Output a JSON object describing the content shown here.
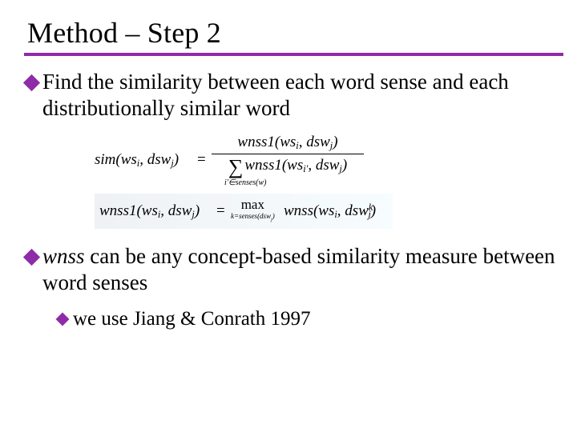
{
  "title": "Method – Step 2",
  "bullets": {
    "b1": "Find the similarity between each word sense and each distributionally similar word",
    "b2_lead": "wnss",
    "b2_rest": " can be any concept-based similarity measure between word senses",
    "b2_sub": "we use Jiang & Conrath 1997"
  },
  "equations": {
    "eq1": {
      "lhs": "sim(ws_i, dsw_j)",
      "numerator": "wnss1(ws_i, dsw_j)",
      "denominator_sum_sub": "i'∈senses(w)",
      "denominator_term": "wnss1(ws_{i'}, dsw_j)"
    },
    "eq2": {
      "lhs": "wnss1(ws_i, dsw_j)",
      "operator": "max",
      "operator_sub": "k=senses(dsw_j)",
      "rhs": "wnss(ws_i, dsw_j^k)"
    }
  }
}
